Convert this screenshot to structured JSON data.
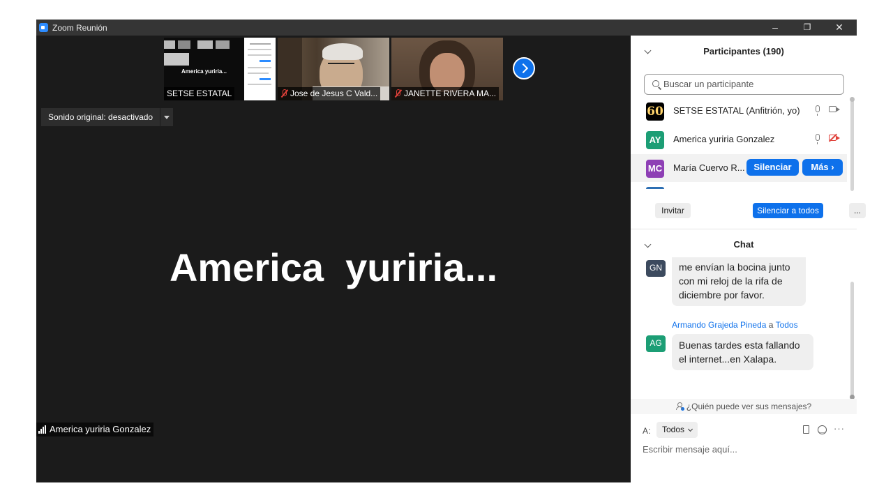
{
  "window": {
    "title": "Zoom Reunión",
    "controls": {
      "minimize": "–",
      "restore": "❐",
      "close": "✕"
    }
  },
  "thumbnails": [
    {
      "name": "SETSE ESTATAL",
      "muted": false,
      "inner_text": "America yuriria..."
    },
    {
      "name": "Jose de Jesus C Vald...",
      "muted": true
    },
    {
      "name": "JANETTE RIVERA MA...",
      "muted": true
    }
  ],
  "sound": {
    "label": "Sonido original: desactivado"
  },
  "main_video": {
    "display_name": "America  yuriria...",
    "name_label": "America yuriria Gonzalez"
  },
  "participants": {
    "title": "Participantes (190)",
    "search_placeholder": "Buscar un participante",
    "list": [
      {
        "avatar": "60",
        "name": "SETSE ESTATAL (Anfitrión, yo)",
        "color": "#000000"
      },
      {
        "avatar": "AY",
        "name": "America yuriria Gonzalez",
        "color": "#1c9e75"
      },
      {
        "avatar": "MC",
        "name": "María Cuervo R...",
        "color": "#8e3fb5"
      }
    ],
    "hover_actions": {
      "mute": "Silenciar",
      "more": "Más ›"
    },
    "invite": "Invitar",
    "mute_all": "Silenciar a todos",
    "more": "..."
  },
  "chat": {
    "title": "Chat",
    "messages": [
      {
        "avatar": "GN",
        "color": "#3c4a5e",
        "lines": [
          "me envían la bocina junto",
          "con mi reloj de la rifa de",
          "diciembre por favor."
        ]
      },
      {
        "avatar": "AG",
        "color": "#1c9e75",
        "sender": "Armando Grajeda Pineda",
        "to_word": "a",
        "to": "Todos",
        "lines": [
          "Buenas tardes esta fallando",
          "el internet...en Xalapa."
        ]
      }
    ],
    "who_can_see": "¿Quién puede ver sus mensajes?",
    "to_label": "A:",
    "to_value": "Todos",
    "more": "···",
    "input_placeholder": "Escribir mensaje aquí..."
  }
}
